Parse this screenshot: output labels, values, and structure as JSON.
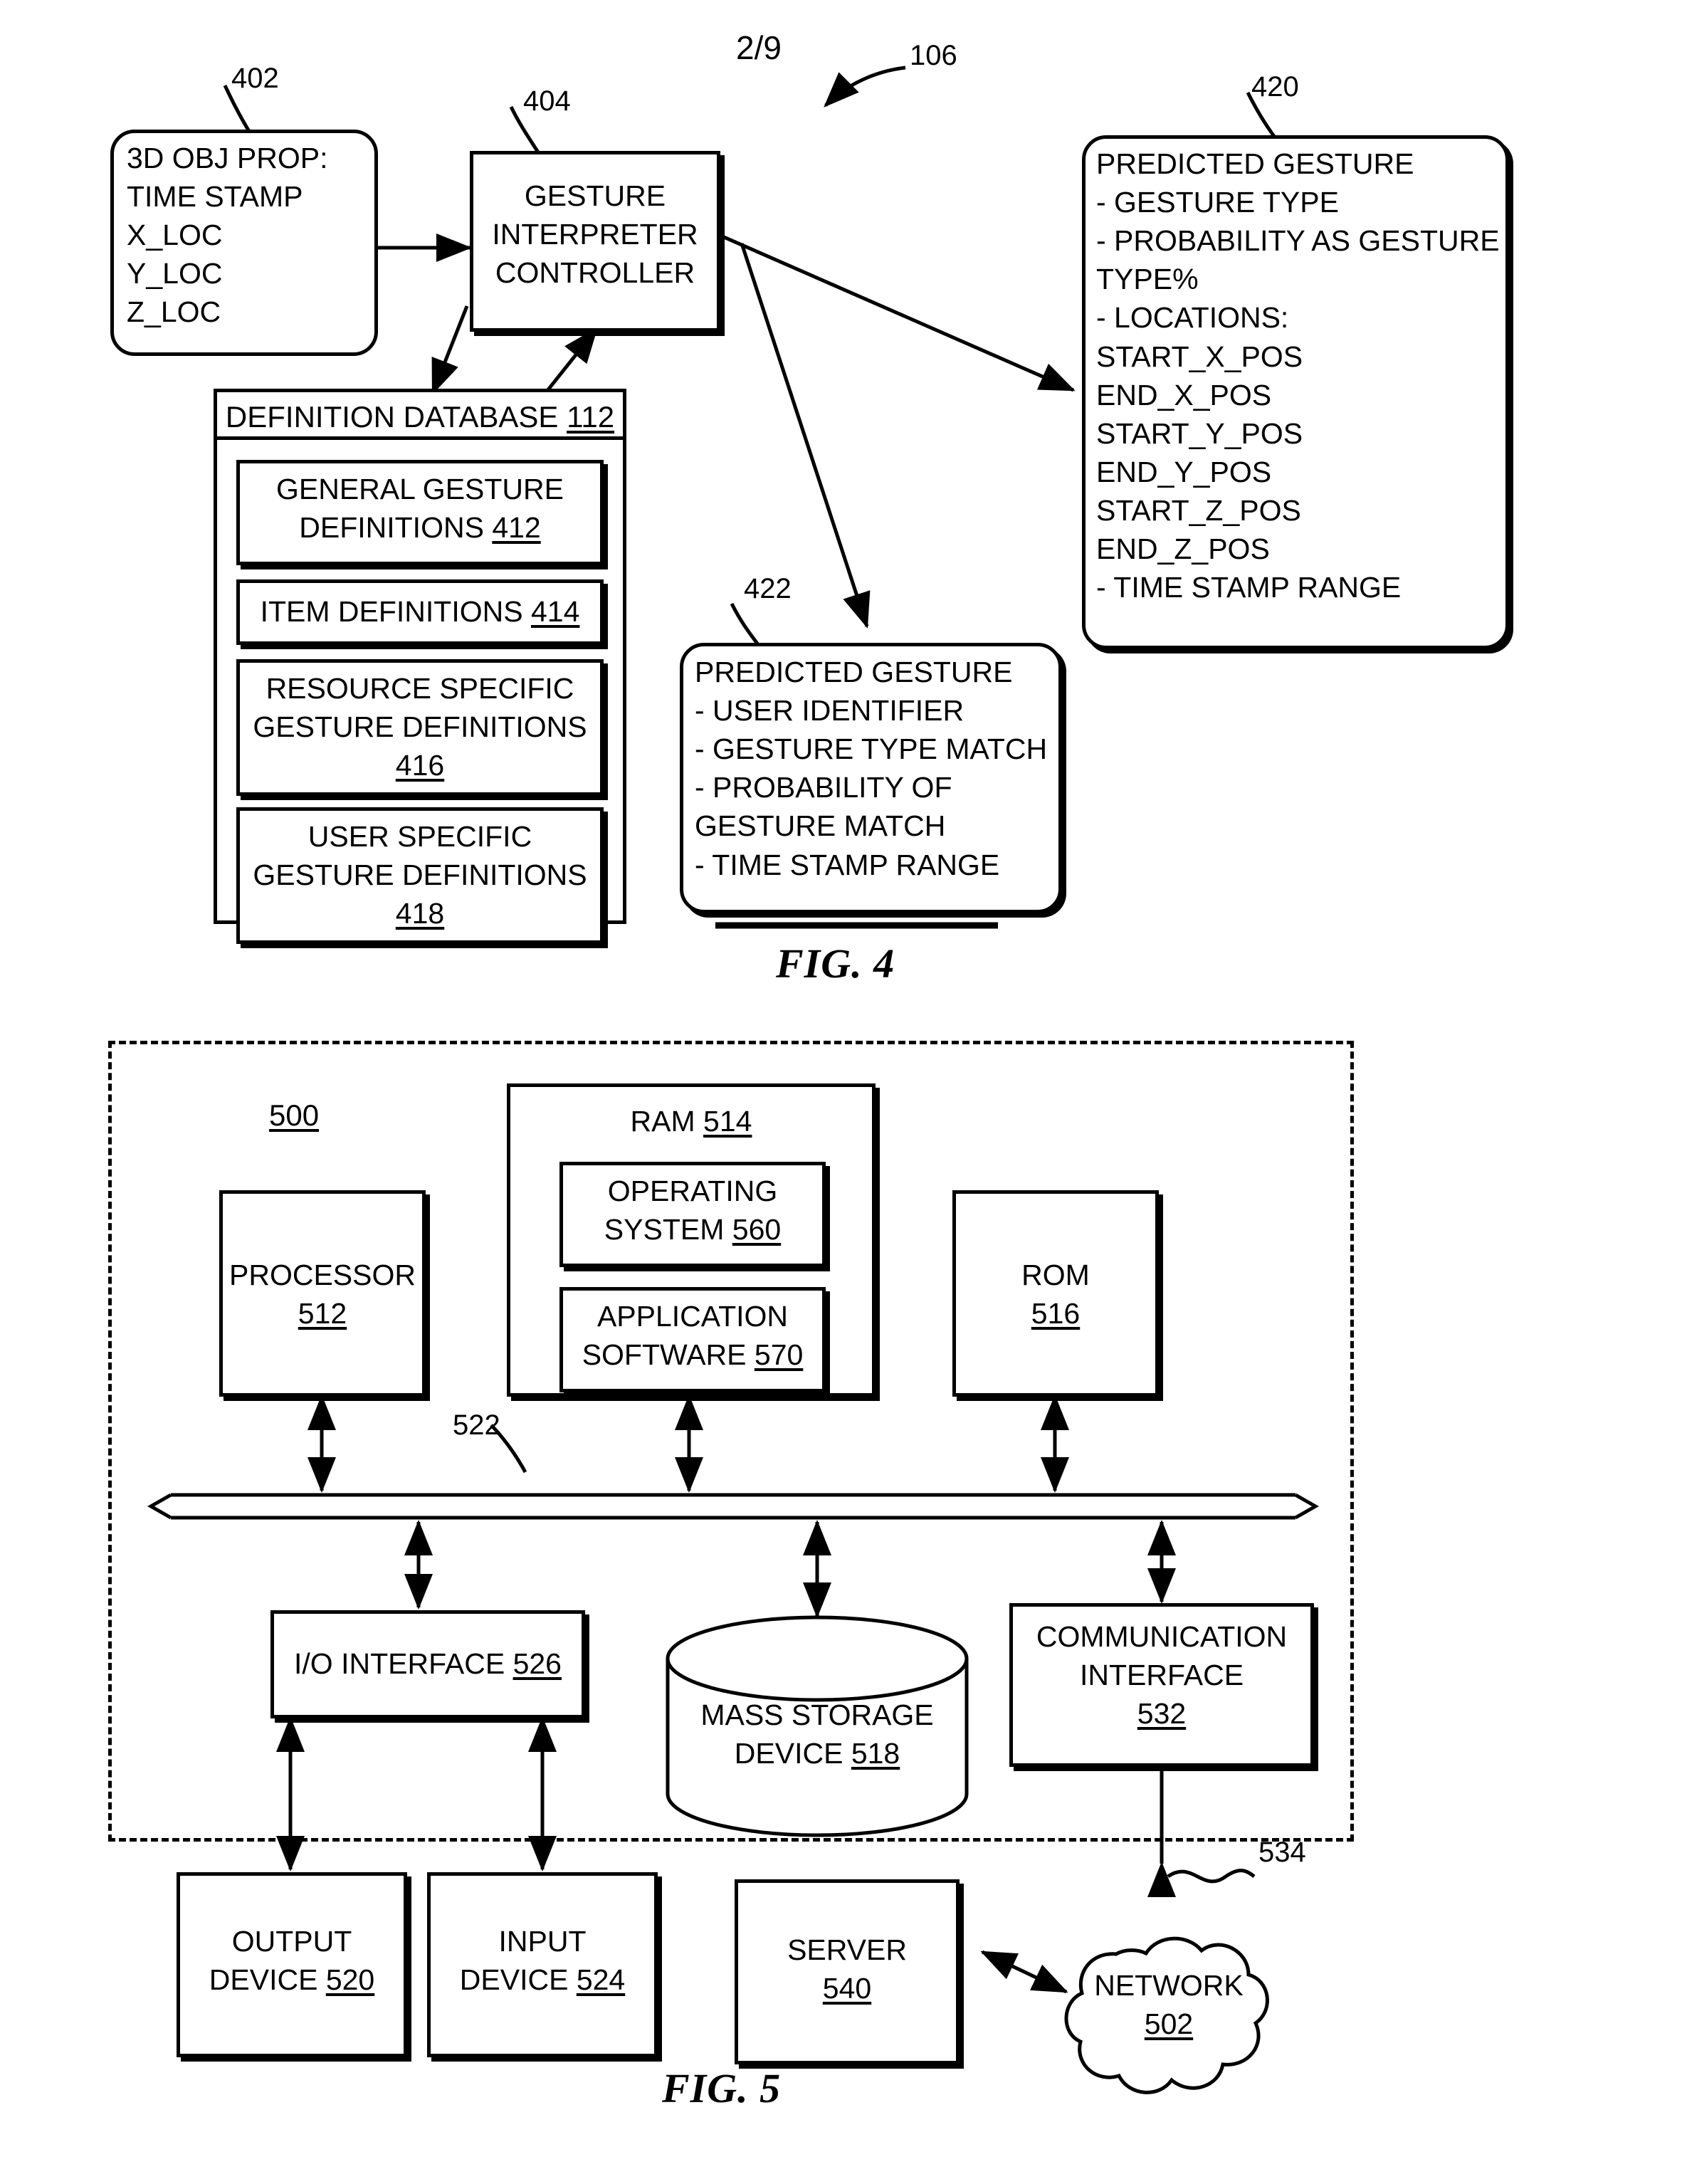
{
  "sheet": {
    "number": "2/9"
  },
  "figure4": {
    "caption": "FIG. 4",
    "ref_106": "106",
    "obj_prop": {
      "ref": "402",
      "text": "3D OBJ PROP:\nTIME STAMP\nX_LOC\nY_LOC\nZ_LOC"
    },
    "controller": {
      "ref": "404",
      "text": "GESTURE\nINTERPRETER\nCONTROLLER"
    },
    "definition_database": {
      "title": "DEFINITION DATABASE ",
      "ref": "112",
      "items": [
        {
          "label": "GENERAL GESTURE\nDEFINITIONS ",
          "ref": "412"
        },
        {
          "label": "ITEM DEFINITIONS ",
          "ref": "414"
        },
        {
          "label": "RESOURCE SPECIFIC\nGESTURE DEFINITIONS\n",
          "ref": "416"
        },
        {
          "label": "USER SPECIFIC\nGESTURE DEFINITIONS\n",
          "ref": "418"
        }
      ]
    },
    "predicted_gesture_422": {
      "ref": "422",
      "text": "PREDICTED GESTURE\n- USER IDENTIFIER\n- GESTURE TYPE MATCH\n- PROBABILITY OF\nGESTURE MATCH\n- TIME STAMP RANGE"
    },
    "predicted_gesture_420": {
      "ref": "420",
      "text": "PREDICTED GESTURE\n- GESTURE TYPE\n- PROBABILITY AS GESTURE\nTYPE%\n- LOCATIONS:\nSTART_X_POS\nEND_X_POS\nSTART_Y_POS\nEND_Y_POS\nSTART_Z_POS\nEND_Z_POS\n- TIME STAMP RANGE"
    }
  },
  "figure5": {
    "caption": "FIG. 5",
    "system_ref": "500",
    "bus_ref": "522",
    "network_link_ref": "534",
    "processor": {
      "label": "PROCESSOR\n",
      "ref": "512"
    },
    "ram": {
      "label": "RAM  ",
      "ref": "514"
    },
    "operating_system": {
      "label": "OPERATING\nSYSTEM ",
      "ref": "560"
    },
    "application_software": {
      "label": "APPLICATION\nSOFTWARE ",
      "ref": "570"
    },
    "rom": {
      "label": "ROM\n",
      "ref": "516"
    },
    "io_interface": {
      "label": "I/O INTERFACE ",
      "ref": "526"
    },
    "mass_storage": {
      "label": "MASS STORAGE\nDEVICE ",
      "ref": "518"
    },
    "communication_interface": {
      "label": "COMMUNICATION\nINTERFACE\n",
      "ref": "532"
    },
    "output_device": {
      "label": "OUTPUT\nDEVICE ",
      "ref": "520"
    },
    "input_device": {
      "label": "INPUT\nDEVICE ",
      "ref": "524"
    },
    "server": {
      "label": "SERVER\n",
      "ref": "540"
    },
    "network": {
      "label": "NETWORK\n",
      "ref": "502"
    }
  }
}
